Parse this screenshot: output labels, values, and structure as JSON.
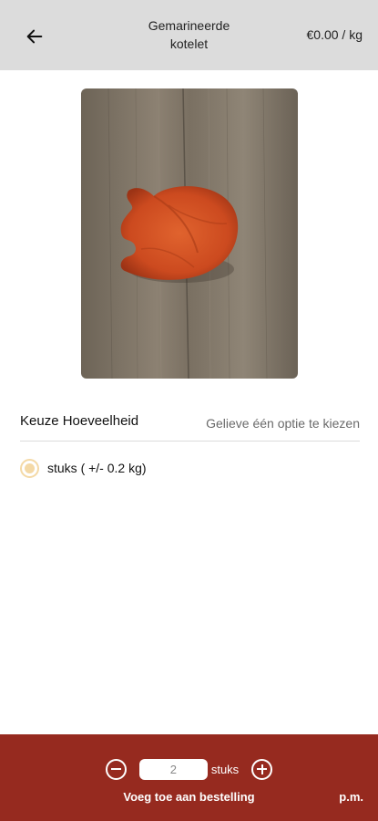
{
  "header": {
    "title_line1": "Gemarineerde",
    "title_line2": "kotelet",
    "price": "€0.00 / kg"
  },
  "icons": {
    "back": "arrow-left-icon",
    "minus": "minus-circle-icon",
    "plus": "plus-circle-icon"
  },
  "option": {
    "label": "Keuze Hoeveelheid",
    "hint": "Gelieve één optie te kiezen",
    "choices": [
      {
        "label": "stuks ( +/- 0.2 kg)"
      }
    ]
  },
  "footer": {
    "quantity": "2",
    "unit": "stuks",
    "add_label": "Voeg toe aan bestelling",
    "price": "p.m."
  },
  "colors": {
    "header_bg": "#dcdcdc",
    "footer_bg": "#962a1f",
    "radio_accent": "#f4d9a6"
  }
}
